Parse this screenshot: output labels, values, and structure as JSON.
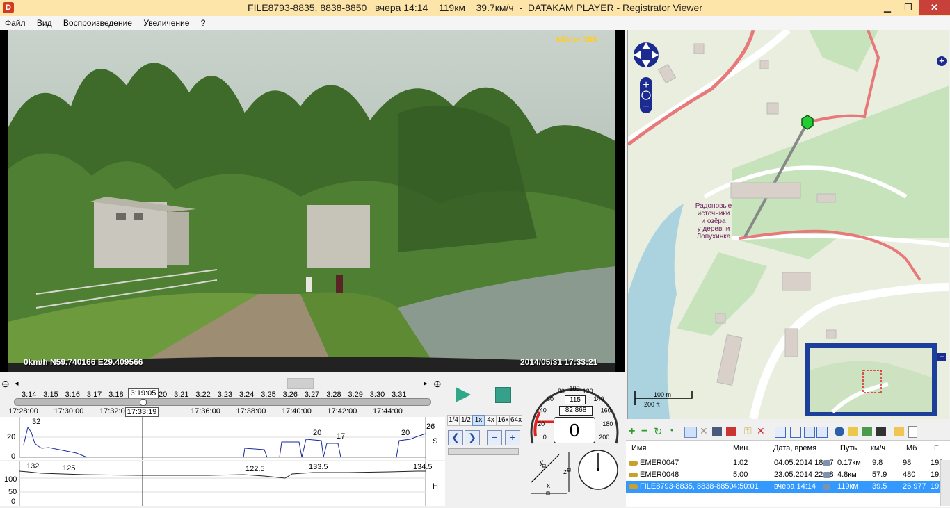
{
  "window": {
    "title": "FILE8793-8835, 8838-8850   вчера 14:14    119км    39.7км/ч  -  DATAKAM PLAYER - Registrator Viewer",
    "app_icon_letter": "D",
    "minimize_glyph": "▁",
    "restore_glyph": "❐",
    "close_glyph": "✕"
  },
  "menu": [
    "Файл",
    "Вид",
    "Воспроизведение",
    "Увеличение",
    "?"
  ],
  "video": {
    "brand": "MiVue 388",
    "gps_overlay": "0km/h N59.740166 E29.409566",
    "date_overlay": "2014/05/31 17:33:21"
  },
  "map": {
    "label_lines": [
      "Радоновые",
      "источники",
      "и озёра",
      "у деревни",
      "Лопухинка"
    ],
    "scale_m": "100 m",
    "scale_ft": "200 ft"
  },
  "timeline": {
    "minute_ticks": [
      "3:14",
      "3:15",
      "3:16",
      "3:17",
      "3:18",
      "3:19:05",
      "3:20",
      "3:21",
      "3:22",
      "3:23",
      "3:24",
      "3:25",
      "3:26",
      "3:27",
      "3:28",
      "3:29",
      "3:30",
      "3:31"
    ],
    "clock_ticks": [
      "17:28:00",
      "17:30:00",
      "17:32:00",
      "17:33:19",
      "17:36:00",
      "17:38:00",
      "17:40:00",
      "17:42:00",
      "17:44:00"
    ],
    "current_marker": "3:19:05",
    "current_clock": "17:33:19",
    "position": 0.31
  },
  "graph_speed": {
    "axis_label": "S",
    "y_ticks": [
      "20",
      "0"
    ],
    "peak_labels": [
      "32",
      "20",
      "17",
      "20",
      "26"
    ]
  },
  "graph_height": {
    "axis_label": "H",
    "y_ticks": [
      "100",
      "50",
      "0"
    ],
    "peak_labels": [
      "132",
      "125",
      "122.5",
      "133.5",
      "134.5"
    ]
  },
  "playback": {
    "speeds": [
      "1/4",
      "1/2",
      "1x",
      "4x",
      "16x",
      "64x"
    ],
    "active_speed": "1x",
    "prev_glyph": "❮",
    "next_glyph": "❯",
    "zoom_out_glyph": "−",
    "zoom_in_glyph": "+"
  },
  "speedometer": {
    "ticks": [
      "0",
      "20",
      "40",
      "60",
      "80",
      "100",
      "120",
      "140",
      "160",
      "180",
      "200"
    ],
    "top_value": "115",
    "odometer": "82 868",
    "current_speed": "0"
  },
  "axes_widget": {
    "x": "x",
    "y": "y",
    "z": "z"
  },
  "file_list": {
    "headers": [
      "Имя",
      "Мин.",
      "Дата, время",
      "Путь",
      "км/ч",
      "Мб",
      "F"
    ],
    "rows": [
      {
        "name": "EMER0047",
        "min": "1:02",
        "date": "04.05.2014 18:47",
        "path": "0.17км",
        "kmh": "9.8",
        "mb": "98",
        "f": "192",
        "selected": false
      },
      {
        "name": "EMER0048",
        "min": "5:00",
        "date": "23.05.2014 22:48",
        "path": "4.8км",
        "kmh": "57.9",
        "mb": "480",
        "f": "192",
        "selected": false
      },
      {
        "name": "FILE8793-8835, 8838-8850",
        "min": "4:50:01",
        "date": "вчера 14:14",
        "path": "119км",
        "kmh": "39.5",
        "mb": "26 977",
        "f": "192",
        "selected": true
      }
    ]
  },
  "colors": {
    "title_bar": "#fde4a8",
    "selection": "#3399ff",
    "play": "#2fa889",
    "graph_line": "#1a2a9c",
    "route": "#e8797a"
  }
}
